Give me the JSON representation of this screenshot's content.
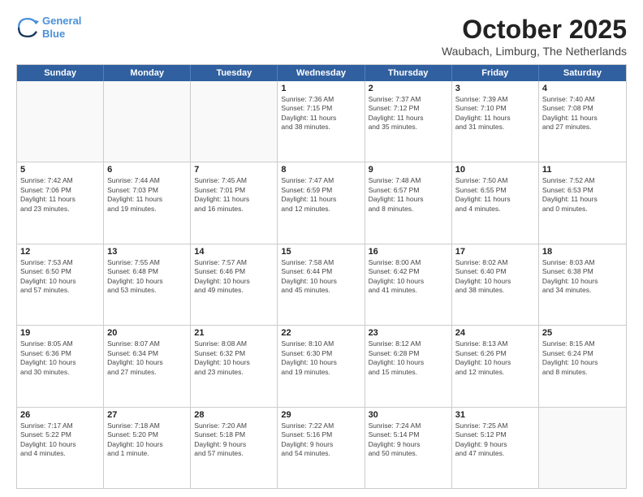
{
  "header": {
    "logo_line1": "General",
    "logo_line2": "Blue",
    "month": "October 2025",
    "location": "Waubach, Limburg, The Netherlands"
  },
  "days_of_week": [
    "Sunday",
    "Monday",
    "Tuesday",
    "Wednesday",
    "Thursday",
    "Friday",
    "Saturday"
  ],
  "weeks": [
    [
      {
        "day": "",
        "info": "",
        "empty": true
      },
      {
        "day": "",
        "info": "",
        "empty": true
      },
      {
        "day": "",
        "info": "",
        "empty": true
      },
      {
        "day": "1",
        "info": "Sunrise: 7:36 AM\nSunset: 7:15 PM\nDaylight: 11 hours\nand 38 minutes."
      },
      {
        "day": "2",
        "info": "Sunrise: 7:37 AM\nSunset: 7:12 PM\nDaylight: 11 hours\nand 35 minutes."
      },
      {
        "day": "3",
        "info": "Sunrise: 7:39 AM\nSunset: 7:10 PM\nDaylight: 11 hours\nand 31 minutes."
      },
      {
        "day": "4",
        "info": "Sunrise: 7:40 AM\nSunset: 7:08 PM\nDaylight: 11 hours\nand 27 minutes."
      }
    ],
    [
      {
        "day": "5",
        "info": "Sunrise: 7:42 AM\nSunset: 7:06 PM\nDaylight: 11 hours\nand 23 minutes."
      },
      {
        "day": "6",
        "info": "Sunrise: 7:44 AM\nSunset: 7:03 PM\nDaylight: 11 hours\nand 19 minutes."
      },
      {
        "day": "7",
        "info": "Sunrise: 7:45 AM\nSunset: 7:01 PM\nDaylight: 11 hours\nand 16 minutes."
      },
      {
        "day": "8",
        "info": "Sunrise: 7:47 AM\nSunset: 6:59 PM\nDaylight: 11 hours\nand 12 minutes."
      },
      {
        "day": "9",
        "info": "Sunrise: 7:48 AM\nSunset: 6:57 PM\nDaylight: 11 hours\nand 8 minutes."
      },
      {
        "day": "10",
        "info": "Sunrise: 7:50 AM\nSunset: 6:55 PM\nDaylight: 11 hours\nand 4 minutes."
      },
      {
        "day": "11",
        "info": "Sunrise: 7:52 AM\nSunset: 6:53 PM\nDaylight: 11 hours\nand 0 minutes."
      }
    ],
    [
      {
        "day": "12",
        "info": "Sunrise: 7:53 AM\nSunset: 6:50 PM\nDaylight: 10 hours\nand 57 minutes."
      },
      {
        "day": "13",
        "info": "Sunrise: 7:55 AM\nSunset: 6:48 PM\nDaylight: 10 hours\nand 53 minutes."
      },
      {
        "day": "14",
        "info": "Sunrise: 7:57 AM\nSunset: 6:46 PM\nDaylight: 10 hours\nand 49 minutes."
      },
      {
        "day": "15",
        "info": "Sunrise: 7:58 AM\nSunset: 6:44 PM\nDaylight: 10 hours\nand 45 minutes."
      },
      {
        "day": "16",
        "info": "Sunrise: 8:00 AM\nSunset: 6:42 PM\nDaylight: 10 hours\nand 41 minutes."
      },
      {
        "day": "17",
        "info": "Sunrise: 8:02 AM\nSunset: 6:40 PM\nDaylight: 10 hours\nand 38 minutes."
      },
      {
        "day": "18",
        "info": "Sunrise: 8:03 AM\nSunset: 6:38 PM\nDaylight: 10 hours\nand 34 minutes."
      }
    ],
    [
      {
        "day": "19",
        "info": "Sunrise: 8:05 AM\nSunset: 6:36 PM\nDaylight: 10 hours\nand 30 minutes."
      },
      {
        "day": "20",
        "info": "Sunrise: 8:07 AM\nSunset: 6:34 PM\nDaylight: 10 hours\nand 27 minutes."
      },
      {
        "day": "21",
        "info": "Sunrise: 8:08 AM\nSunset: 6:32 PM\nDaylight: 10 hours\nand 23 minutes."
      },
      {
        "day": "22",
        "info": "Sunrise: 8:10 AM\nSunset: 6:30 PM\nDaylight: 10 hours\nand 19 minutes."
      },
      {
        "day": "23",
        "info": "Sunrise: 8:12 AM\nSunset: 6:28 PM\nDaylight: 10 hours\nand 15 minutes."
      },
      {
        "day": "24",
        "info": "Sunrise: 8:13 AM\nSunset: 6:26 PM\nDaylight: 10 hours\nand 12 minutes."
      },
      {
        "day": "25",
        "info": "Sunrise: 8:15 AM\nSunset: 6:24 PM\nDaylight: 10 hours\nand 8 minutes."
      }
    ],
    [
      {
        "day": "26",
        "info": "Sunrise: 7:17 AM\nSunset: 5:22 PM\nDaylight: 10 hours\nand 4 minutes."
      },
      {
        "day": "27",
        "info": "Sunrise: 7:18 AM\nSunset: 5:20 PM\nDaylight: 10 hours\nand 1 minute."
      },
      {
        "day": "28",
        "info": "Sunrise: 7:20 AM\nSunset: 5:18 PM\nDaylight: 9 hours\nand 57 minutes."
      },
      {
        "day": "29",
        "info": "Sunrise: 7:22 AM\nSunset: 5:16 PM\nDaylight: 9 hours\nand 54 minutes."
      },
      {
        "day": "30",
        "info": "Sunrise: 7:24 AM\nSunset: 5:14 PM\nDaylight: 9 hours\nand 50 minutes."
      },
      {
        "day": "31",
        "info": "Sunrise: 7:25 AM\nSunset: 5:12 PM\nDaylight: 9 hours\nand 47 minutes."
      },
      {
        "day": "",
        "info": "",
        "empty": true
      }
    ]
  ]
}
